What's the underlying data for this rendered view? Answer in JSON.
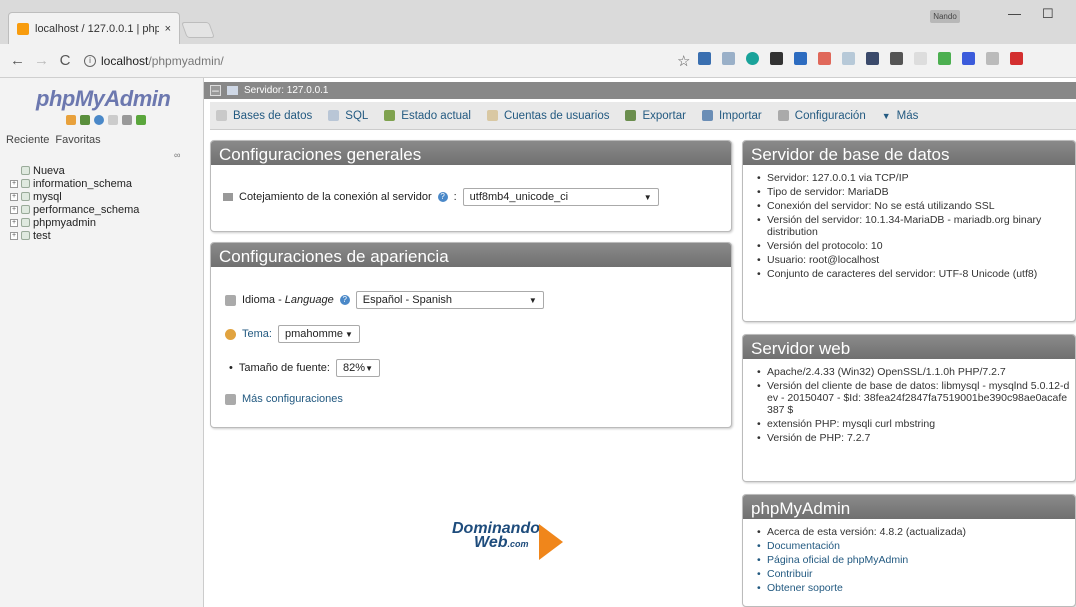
{
  "browser": {
    "tab_title": "localhost / 127.0.0.1 | php",
    "tab_close": "×",
    "url_host": "localhost",
    "url_path": "/phpmyadmin/",
    "profile_name": "Nando",
    "minimize": "—",
    "maximize": "☐",
    "nav": {
      "back": "←",
      "forward": "→",
      "reload": "C"
    },
    "star": "☆"
  },
  "left": {
    "logo_part1": "php",
    "logo_part2": "MyAdmin",
    "tab_recent": "Reciente",
    "tab_favorites": "Favoritas",
    "tree": [
      {
        "label": "Nueva",
        "icon": "new-db-icon"
      },
      {
        "label": "information_schema",
        "icon": "database-icon"
      },
      {
        "label": "mysql",
        "icon": "database-icon"
      },
      {
        "label": "performance_schema",
        "icon": "database-icon"
      },
      {
        "label": "phpmyadmin",
        "icon": "database-icon"
      },
      {
        "label": "test",
        "icon": "database-icon"
      }
    ]
  },
  "main": {
    "server_label": "Servidor: 127.0.0.1",
    "menu": [
      {
        "label": "Bases de datos",
        "icon": "database-icon"
      },
      {
        "label": "SQL",
        "icon": "sql-icon"
      },
      {
        "label": "Estado actual",
        "icon": "status-icon"
      },
      {
        "label": "Cuentas de usuarios",
        "icon": "users-icon"
      },
      {
        "label": "Exportar",
        "icon": "export-icon"
      },
      {
        "label": "Importar",
        "icon": "import-icon"
      },
      {
        "label": "Configuración",
        "icon": "wrench-icon"
      },
      {
        "label": "Más",
        "icon": "caret-down-icon"
      }
    ],
    "general": {
      "title": "Configuraciones generales",
      "collation_label": "Cotejamiento de la conexión al servidor",
      "collation_value": "utf8mb4_unicode_ci"
    },
    "appearance": {
      "title": "Configuraciones de apariencia",
      "language_label": "Idioma - ",
      "language_label_en": "Language",
      "language_value": "Español - Spanish",
      "theme_label": "Tema:",
      "theme_value": "pmahomme",
      "font_label": "Tamaño de fuente:",
      "font_value": "82%",
      "more_link": "Más configuraciones"
    },
    "db_server": {
      "title": "Servidor de base de datos",
      "items": [
        "Servidor: 127.0.0.1 via TCP/IP",
        "Tipo de servidor: MariaDB",
        "Conexión del servidor: No se está utilizando SSL",
        "Versión del servidor: 10.1.34-MariaDB - mariadb.org binary distribution",
        "Versión del protocolo: 10",
        "Usuario: root@localhost",
        "Conjunto de caracteres del servidor: UTF-8 Unicode (utf8)"
      ]
    },
    "web_server": {
      "title": "Servidor web",
      "items": [
        "Apache/2.4.33 (Win32) OpenSSL/1.1.0h PHP/7.2.7",
        "Versión del cliente de base de datos: libmysql - mysqlnd 5.0.12-dev - 20150407 - $Id: 38fea24f2847fa7519001be390c98ae0acafe387 $",
        "extensión PHP: mysqli  curl  mbstring",
        "Versión de PHP: 7.2.7"
      ]
    },
    "pma": {
      "title": "phpMyAdmin",
      "items": [
        "Acerca de esta versión: 4.8.2 (actualizada)",
        "Documentación",
        "Página oficial de phpMyAdmin",
        "Contribuir",
        "Obtener soporte"
      ]
    },
    "brand": {
      "line1": "Dominando",
      "line2": "Web",
      "suffix": ".com"
    }
  }
}
